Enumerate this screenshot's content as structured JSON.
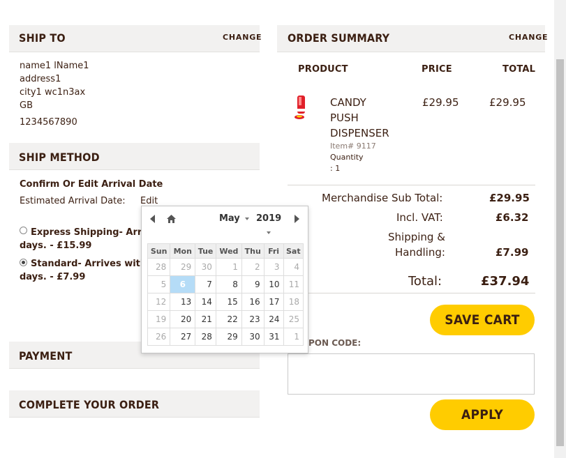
{
  "ship_to": {
    "title": "SHIP TO",
    "change": "CHANGE",
    "lines": [
      "name1 lName1",
      "address1",
      "city1 wc1n3ax",
      "GB",
      "1234567890"
    ]
  },
  "ship_method": {
    "title": "SHIP METHOD",
    "confirm_label": "Confirm Or Edit Arrival Date",
    "estimated_label": "Estimated Arrival Date:",
    "edit_link": "Edit",
    "options": [
      {
        "line1": "Express Shipping- Arrives",
        "line2": "days.  - £15.99",
        "selected": false
      },
      {
        "line1": "Standard- Arrives within",
        "line2": "days.  - £7.99",
        "selected": true
      }
    ]
  },
  "payment": {
    "title": "PAYMENT"
  },
  "complete": {
    "title": "COMPLETE YOUR ORDER"
  },
  "order_summary": {
    "title": "ORDER SUMMARY",
    "change": "CHANGE",
    "columns": [
      "PRODUCT",
      "PRICE",
      "TOTAL"
    ],
    "item": {
      "name_lines": [
        "CANDY",
        "PUSH",
        "DISPENSER"
      ],
      "item_no": "Item# 9117",
      "qty_label": "Quantity",
      "qty_value": ": 1",
      "price": "£29.95",
      "total": "£29.95"
    },
    "totals": {
      "merch_label": "Merchandise Sub Total:",
      "merch_value": "£29.95",
      "vat_label": "Incl. VAT:",
      "vat_value": "£6.32",
      "ship_label_1": "Shipping &",
      "ship_label_2": "Handling:",
      "ship_value": "£7.99",
      "total_label": "Total:",
      "total_value": "£37.94"
    },
    "save_cart": "SAVE CART",
    "coupon_label": "PON CODE:",
    "apply": "APPLY"
  },
  "calendar": {
    "month": "May",
    "year": "2019",
    "weekdays": [
      "Sun",
      "Mon",
      "Tue",
      "Wed",
      "Thu",
      "Fri",
      "Sat"
    ],
    "weeks": [
      [
        "28",
        "29",
        "30",
        "1",
        "2",
        "3",
        "4"
      ],
      [
        "5",
        "6",
        "7",
        "8",
        "9",
        "10",
        "11"
      ],
      [
        "12",
        "13",
        "14",
        "15",
        "16",
        "17",
        "18"
      ],
      [
        "19",
        "20",
        "21",
        "22",
        "23",
        "24",
        "25"
      ],
      [
        "26",
        "27",
        "28",
        "29",
        "30",
        "31",
        "1"
      ]
    ],
    "muted": [
      [
        0,
        0
      ],
      [
        0,
        1
      ],
      [
        0,
        2
      ],
      [
        0,
        3
      ],
      [
        0,
        4
      ],
      [
        0,
        5
      ],
      [
        0,
        6
      ],
      [
        1,
        0
      ],
      [
        1,
        6
      ],
      [
        2,
        0
      ],
      [
        2,
        6
      ],
      [
        3,
        0
      ],
      [
        3,
        6
      ],
      [
        4,
        0
      ],
      [
        4,
        6
      ]
    ],
    "selected": [
      1,
      1
    ]
  },
  "colors": {
    "accent": "#ffcc00",
    "text": "#3b1f12",
    "header_bg": "#f2f1f0",
    "today": "#b5dcf7"
  }
}
